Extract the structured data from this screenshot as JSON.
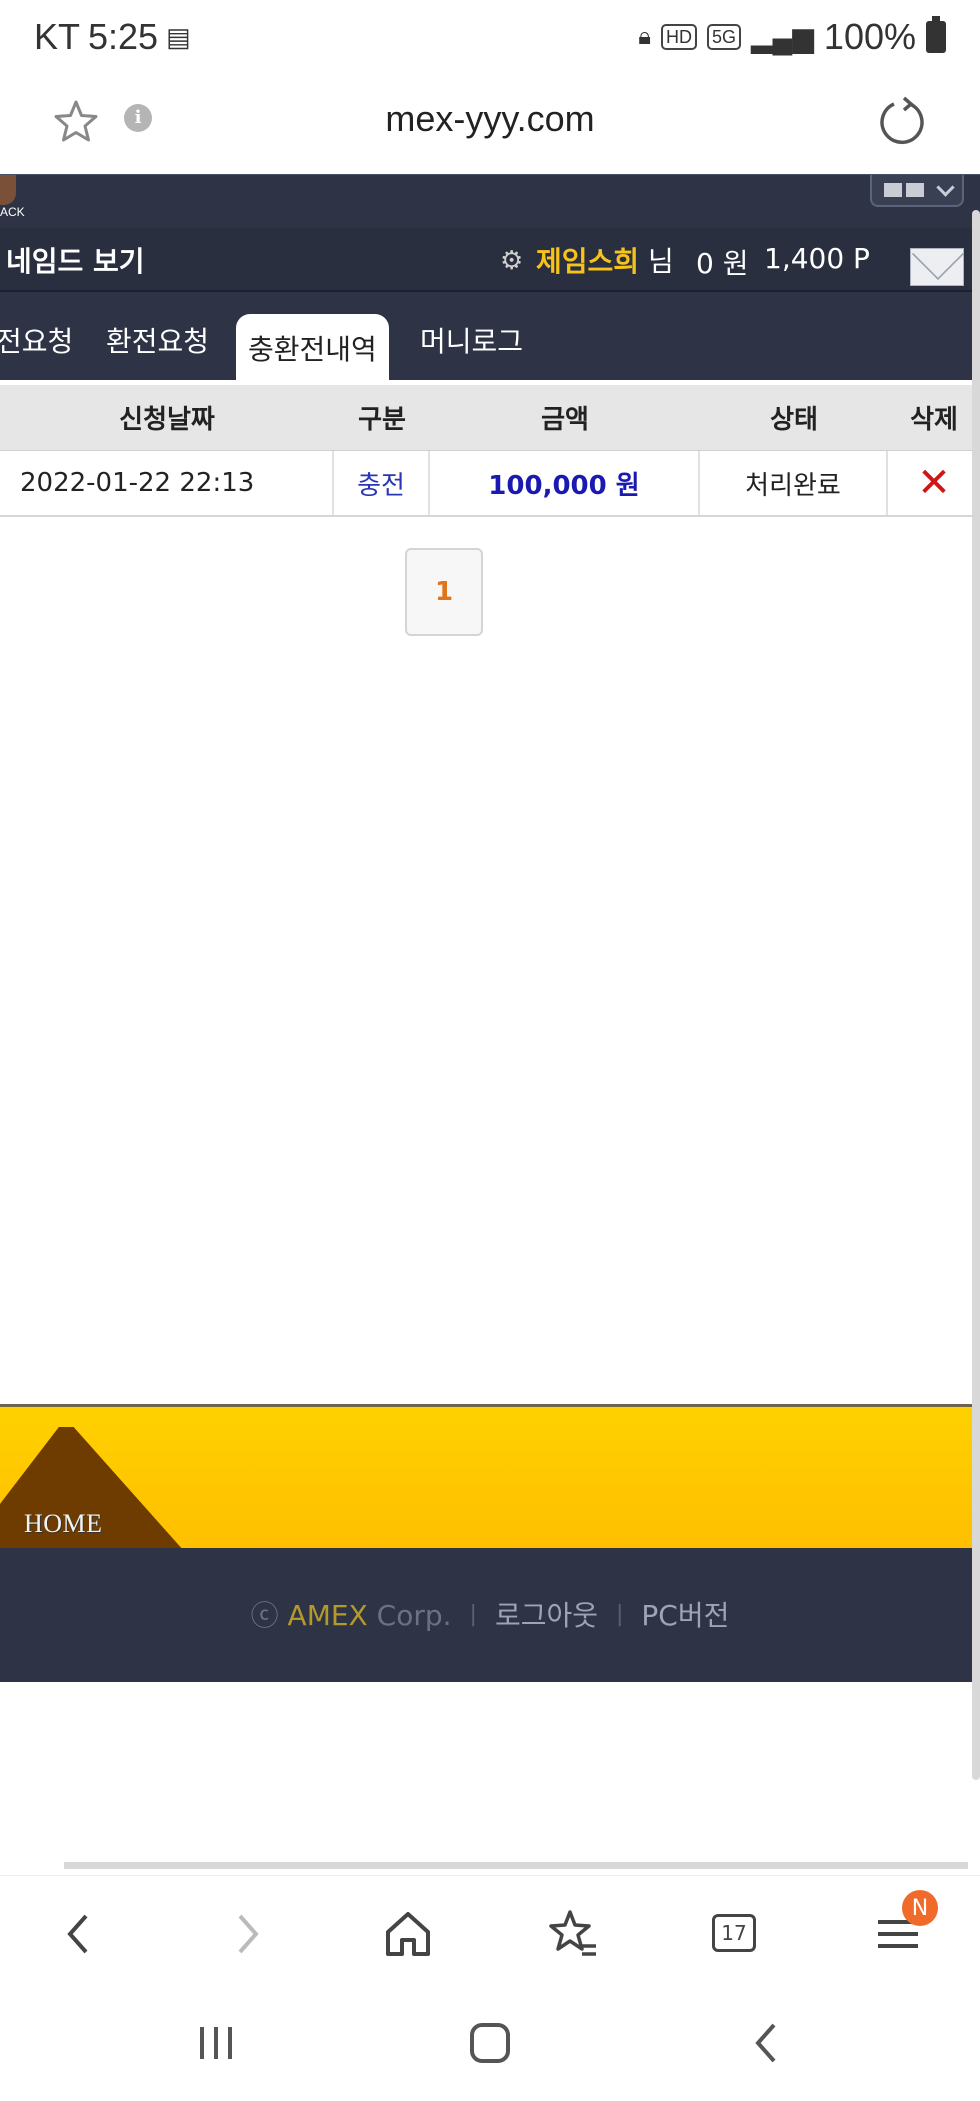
{
  "status_bar": {
    "carrier": "KT",
    "time": "5:25",
    "hd": "HD",
    "network": "5G",
    "battery": "100%"
  },
  "browser": {
    "url": "mex-yyy.com",
    "tab_count": "17",
    "menu_badge": "N"
  },
  "site": {
    "logo_fragment": "ACK",
    "named_view": "네임드 보기",
    "user": {
      "name": "제임스희",
      "suffix": "님",
      "money": "0 원",
      "points": "1,400 P"
    },
    "tabs": [
      {
        "label": "전요청",
        "active": false
      },
      {
        "label": "환전요청",
        "active": false
      },
      {
        "label": "충환전내역",
        "active": true
      },
      {
        "label": "머니로그",
        "active": false
      }
    ]
  },
  "table": {
    "headers": {
      "date": "신청날짜",
      "type": "구분",
      "amount": "금액",
      "status": "상태",
      "delete": "삭제"
    },
    "rows": [
      {
        "date": "2022-01-22 22:13",
        "type": "충전",
        "amount": "100,000 원",
        "status": "처리완료",
        "delete": "✕"
      }
    ]
  },
  "pagination": {
    "current": "1"
  },
  "footer": {
    "home": "HOME",
    "copyright": "ⓒ",
    "brand": "AMEX",
    "corp": "Corp.",
    "logout": "로그아웃",
    "pc_version": "PC버전"
  },
  "colors": {
    "site_dark": "#2e3446",
    "user_gold": "#f7c21a",
    "footer_yellow": "#ffc800",
    "amount_blue": "#1a1ab0",
    "delete_red": "#d01515",
    "pager_orange": "#e0741a"
  }
}
